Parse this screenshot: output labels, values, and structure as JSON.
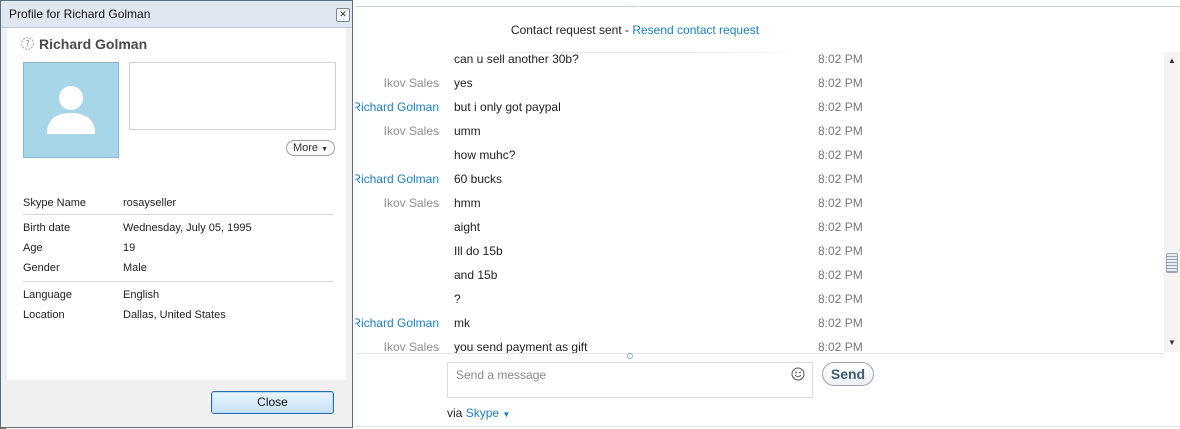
{
  "chat": {
    "status_text": "Contact request sent - ",
    "resend_link": "Resend contact request",
    "messages": [
      {
        "sender": "",
        "text": "can u sell another 30b?",
        "time": "8:02 PM"
      },
      {
        "sender": "Ikov Sales",
        "text": "yes",
        "time": "8:02 PM"
      },
      {
        "sender": "Richard Golman",
        "text": "but i only got paypal",
        "time": "8:02 PM"
      },
      {
        "sender": "Ikov Sales",
        "text": "umm",
        "time": "8:02 PM"
      },
      {
        "sender": "",
        "text": "how muhc?",
        "time": "8:02 PM"
      },
      {
        "sender": "Richard Golman",
        "text": "60 bucks",
        "time": "8:02 PM"
      },
      {
        "sender": "Ikov Sales",
        "text": "hmm",
        "time": "8:02 PM"
      },
      {
        "sender": "",
        "text": "aight",
        "time": "8:02 PM"
      },
      {
        "sender": "",
        "text": "Ill do 15b",
        "time": "8:02 PM"
      },
      {
        "sender": "",
        "text": "and 15b",
        "time": "8:02 PM"
      },
      {
        "sender": "",
        "text": "?",
        "time": "8:02 PM"
      },
      {
        "sender": "Richard Golman",
        "text": "mk",
        "time": "8:02 PM"
      },
      {
        "sender": "Ikov Sales",
        "text": "you send payment as gift",
        "time": "8:02 PM"
      }
    ],
    "input_placeholder": "Send a message",
    "send_label": "Send",
    "via_label": "via",
    "via_service": "Skype"
  },
  "profile": {
    "window_title": "Profile for Richard Golman",
    "name": "Richard Golman",
    "more_label": "More",
    "skype_name_label": "Skype Name",
    "skype_name": "rosayseller",
    "birth_label": "Birth date",
    "birth": "Wednesday, July 05, 1995",
    "age_label": "Age",
    "age": "19",
    "gender_label": "Gender",
    "gender": "Male",
    "language_label": "Language",
    "language": "English",
    "location_label": "Location",
    "location": "Dallas, United States",
    "close_label": "Close"
  },
  "colors": {
    "link": "#1a7fc1",
    "avatar_bg": "#a6d6e7",
    "other_sender": "#8c8c8c"
  }
}
